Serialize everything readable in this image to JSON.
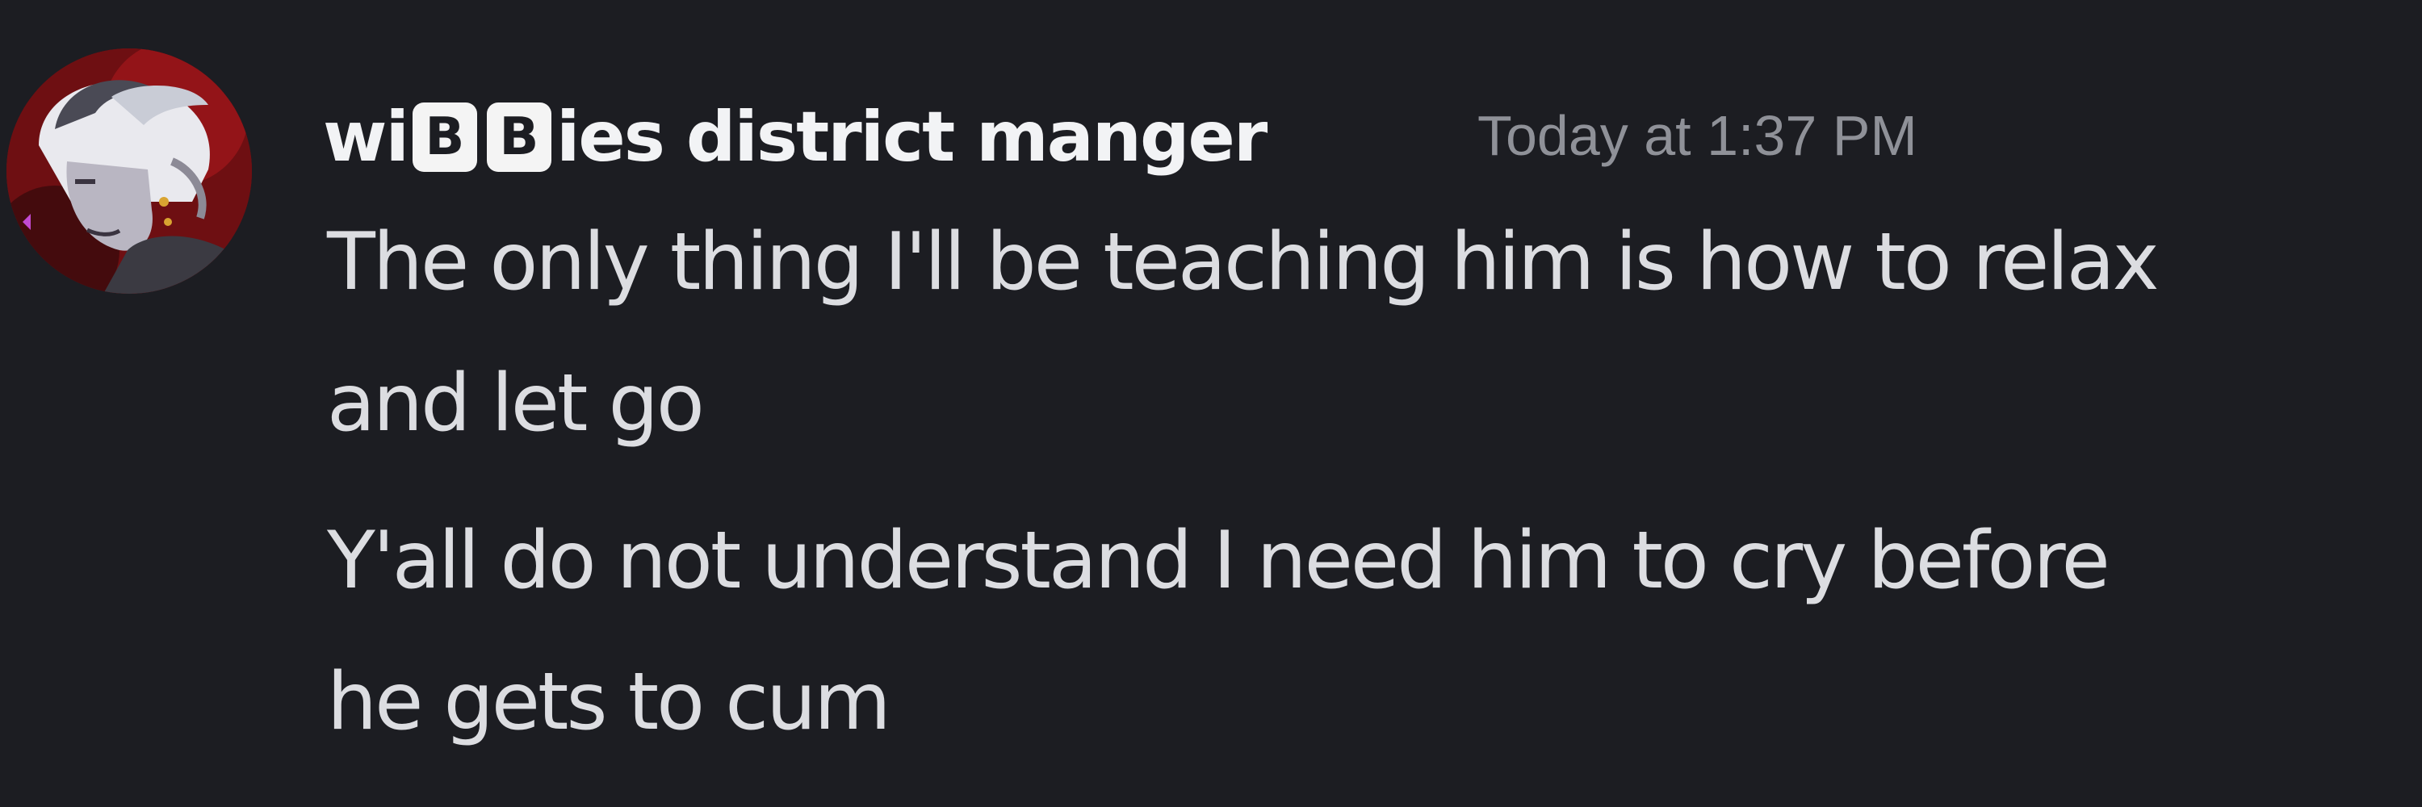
{
  "message": {
    "username": {
      "prefix": "wi",
      "badge_1": "B",
      "badge_2": "B",
      "suffix": "ies district manger"
    },
    "timestamp": "Today at 1:37 PM",
    "lines": [
      "The only thing I'll be teaching him is how to relax",
      "and let go",
      "Y'all do not understand I need him to cry before",
      "he gets to cum"
    ]
  },
  "colors": {
    "background": "#1c1d22",
    "username": "#f2f3f5",
    "timestamp": "#8f9198",
    "message_text": "#dcdde1",
    "badge_bg": "#f4f4f4"
  }
}
